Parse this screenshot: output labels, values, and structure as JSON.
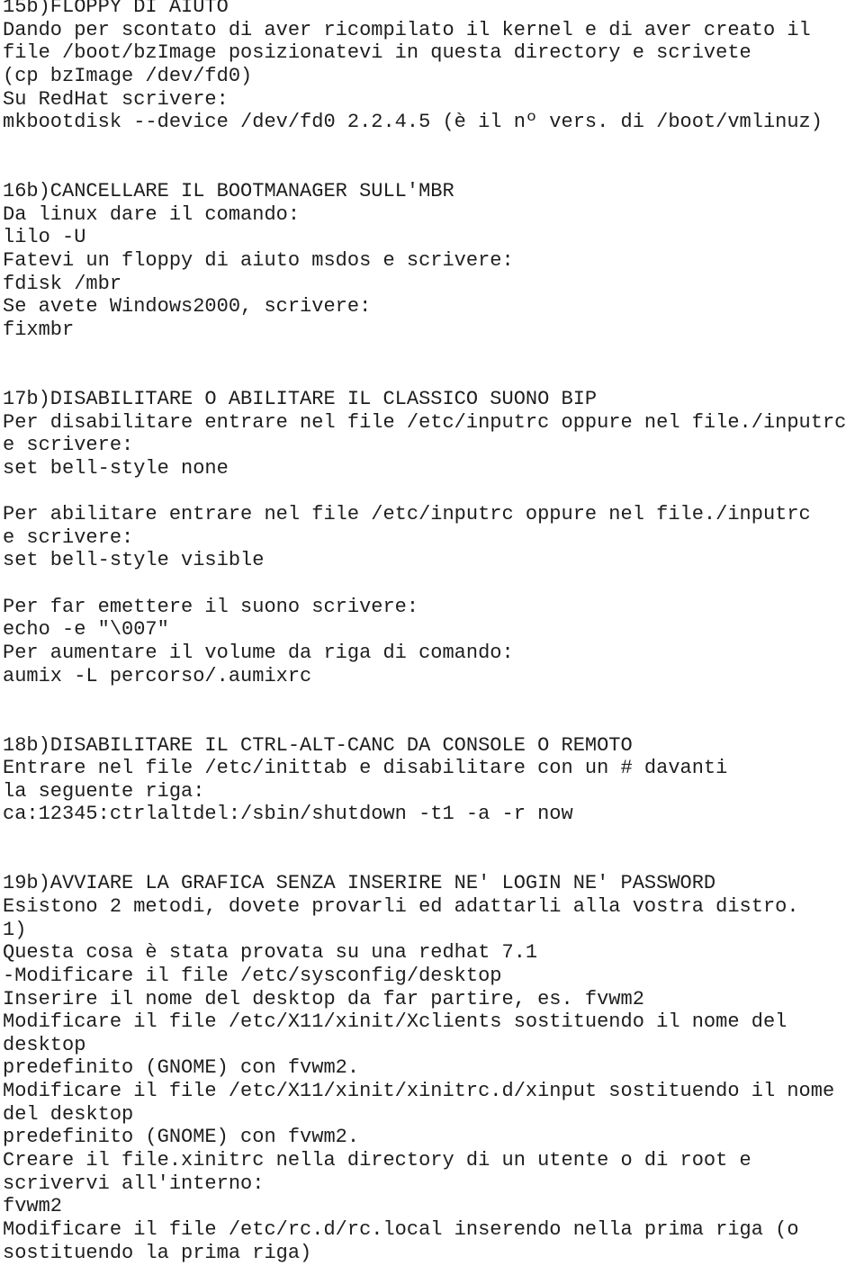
{
  "lines": [
    "15b)FLOPPY DI AIUTO",
    "Dando per scontato di aver ricompilato il kernel e di aver creato il",
    "file /boot/bzImage posizionatevi in questa directory e scrivete",
    "(cp bzImage /dev/fd0)",
    "Su RedHat scrivere:",
    "mkbootdisk --device /dev/fd0 2.2.4.5 (è il nº vers. di /boot/vmlinuz)",
    "",
    "",
    "16b)CANCELLARE IL BOOTMANAGER SULL'MBR",
    "Da linux dare il comando:",
    "lilo -U",
    "Fatevi un floppy di aiuto msdos e scrivere:",
    "fdisk /mbr",
    "Se avete Windows2000, scrivere:",
    "fixmbr",
    "",
    "",
    "17b)DISABILITARE O ABILITARE IL CLASSICO SUONO BIP",
    "Per disabilitare entrare nel file /etc/inputrc oppure nel file./inputrc",
    "e scrivere:",
    "set bell-style none",
    "",
    "Per abilitare entrare nel file /etc/inputrc oppure nel file./inputrc",
    "e scrivere:",
    "set bell-style visible",
    "",
    "Per far emettere il suono scrivere:",
    "echo -e \"\\007\"",
    "Per aumentare il volume da riga di comando:",
    "aumix -L percorso/.aumixrc",
    "",
    "",
    "18b)DISABILITARE IL CTRL-ALT-CANC DA CONSOLE O REMOTO",
    "Entrare nel file /etc/inittab e disabilitare con un # davanti",
    "la seguente riga:",
    "ca:12345:ctrlaltdel:/sbin/shutdown -t1 -a -r now",
    "",
    "",
    "19b)AVVIARE LA GRAFICA SENZA INSERIRE NE' LOGIN NE' PASSWORD",
    "Esistono 2 metodi, dovete provarli ed adattarli alla vostra distro.",
    "1)",
    "Questa cosa è stata provata su una redhat 7.1",
    "-Modificare il file /etc/sysconfig/desktop",
    "Inserire il nome del desktop da far partire, es. fvwm2",
    "Modificare il file /etc/X11/xinit/Xclients sostituendo il nome del",
    "desktop",
    "predefinito (GNOME) con fvwm2.",
    "Modificare il file /etc/X11/xinit/xinitrc.d/xinput sostituendo il nome",
    "del desktop",
    "predefinito (GNOME) con fvwm2.",
    "Creare il file.xinitrc nella directory di un utente o di root e",
    "scrivervi all'interno:",
    "fvwm2",
    "Modificare il file /etc/rc.d/rc.local inserendo nella prima riga (o",
    "sostituendo la prima riga)"
  ]
}
